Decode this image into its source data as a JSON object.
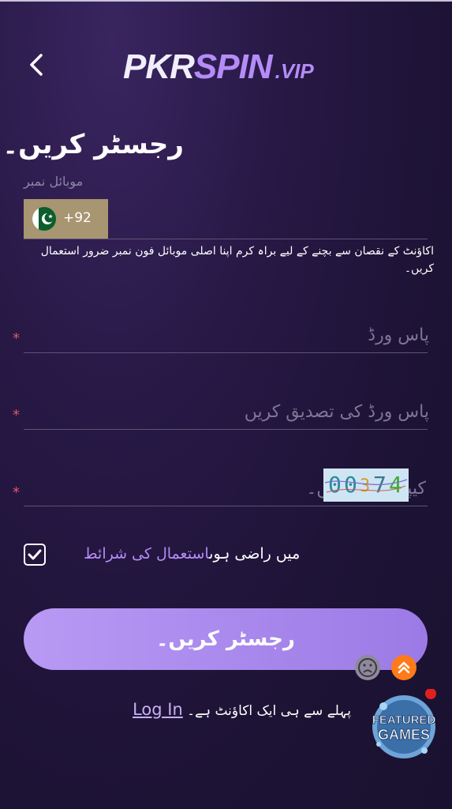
{
  "header": {
    "logo": {
      "pkr": "PKR",
      "spin": "SPIN",
      "vip": ".VIP"
    }
  },
  "form": {
    "title": "رجسٹر کریں۔",
    "mobile_label": "موبائل نمبر",
    "country_code": "+92",
    "phone_hint": "اکاؤنٹ کے نقصان سے بچنے کے لیے براہ کرم اپنا اصلی موبائل فون نمبر ضرور استعمال کریں۔",
    "password_placeholder": "پاس ورڈ",
    "confirm_password_placeholder": "پاس ورڈ کی تصدیق کریں",
    "captcha_placeholder": "کیپچا درج کریں۔",
    "captcha_digits": [
      "0",
      "0",
      "3",
      "7",
      "4"
    ],
    "required_mark": "*",
    "agree_prefix": "میں راضی ہوں",
    "terms_link": "استعمال کی شرائط",
    "submit_label": "رجسٹر کریں۔",
    "login_link": "Log In",
    "have_account_text": "پہلے سے ہی ایک اکاؤنٹ ہے۔"
  },
  "widgets": {
    "featured_line1": "FEATURED",
    "featured_line2": "GAMES"
  },
  "colors": {
    "accent": "#b58cf7",
    "button": "#a98af0",
    "required": "#e0556a",
    "country_bg": "#a89571"
  }
}
